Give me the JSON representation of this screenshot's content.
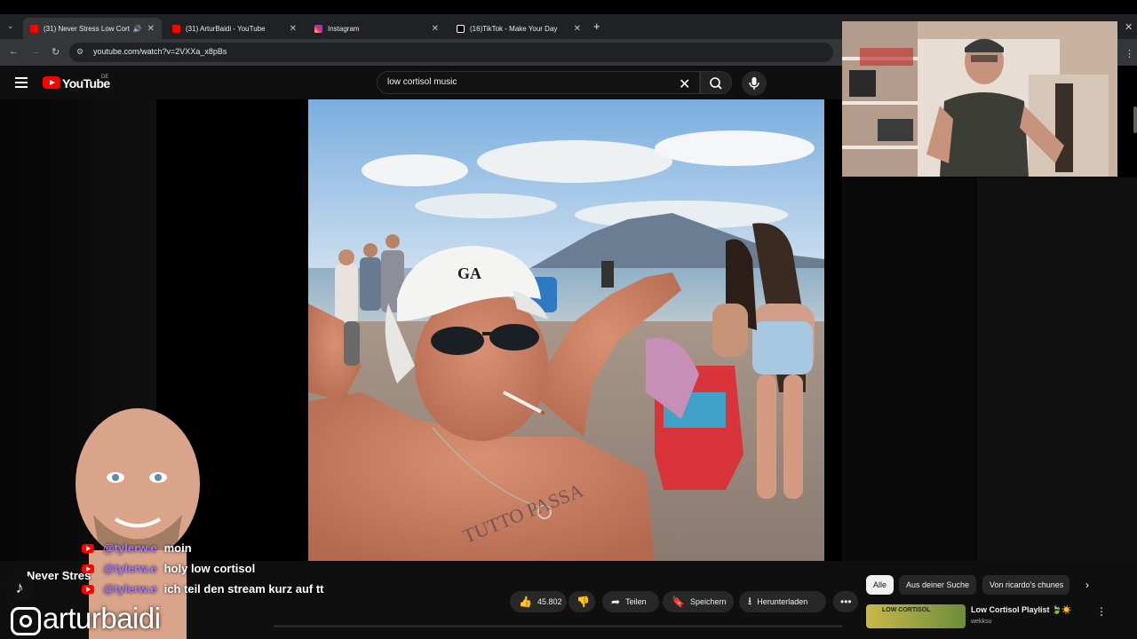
{
  "browser": {
    "tabs": [
      {
        "title": "(31) Never Stress Low Cortisol",
        "color": "#ff0000",
        "active": true
      },
      {
        "title": "(31) ArturBaidi - YouTube",
        "color": "#ff0000",
        "active": false
      },
      {
        "title": "Instagram",
        "color": "#d6249f",
        "active": false
      },
      {
        "title": "(16)TikTok - Make Your Day",
        "color": "#ffffff",
        "active": false
      }
    ],
    "url": "youtube.com/watch?v=2VXXa_x8pBs"
  },
  "youtube": {
    "logo_text": "YouTube",
    "country": "DE",
    "search_value": "low cortisol music"
  },
  "actions": {
    "likes": "45.802",
    "share": "Teilen",
    "save": "Speichern",
    "download": "Herunterladen"
  },
  "filters": {
    "chips": [
      "Alle",
      "Aus deiner Suche",
      "Von ricardo's chunes"
    ]
  },
  "recommendation": {
    "title": "Low Cortisol Playlist 🍃☀️",
    "channel": "wekksu",
    "thumb_text": "LOW CORTISOL"
  },
  "overlay": {
    "chat": [
      {
        "user": "@tylerw.e",
        "message": "moin"
      },
      {
        "user": "@tylerw.e",
        "message": "holy low cortisol"
      },
      {
        "user": "@tylerw.e",
        "message": "ich teil den stream kurz auf tt"
      }
    ],
    "video_title_fragment": "Never Stres",
    "instagram_handle": "arturbaidi",
    "photo_cap_text": "GA",
    "tattoo_text": "TUTTO PASSA"
  },
  "colors": {
    "yt_red": "#ff0000",
    "chat_user": "#a779ff",
    "header_bg": "#0f0f0f"
  }
}
